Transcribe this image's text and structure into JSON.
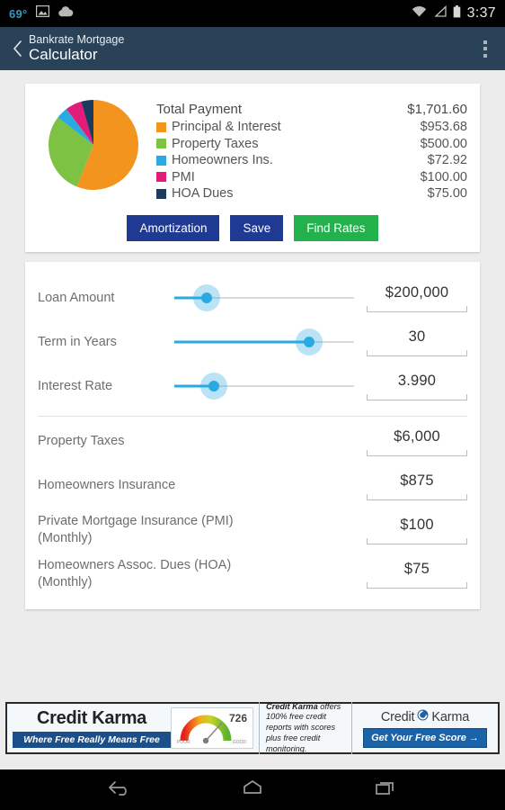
{
  "statusbar": {
    "temperature": "69°",
    "photo_icon": "photo-icon",
    "cloud_icon": "cloud-upload-icon",
    "wifi_icon": "wifi-icon",
    "signal_icon": "signal-icon",
    "battery_icon": "battery-icon",
    "time": "3:37"
  },
  "appbar": {
    "back_icon": "back-chevron-icon",
    "title_line1": "Bankrate Mortgage",
    "title_line2": "Calculator",
    "overflow_icon": "overflow-menu-icon"
  },
  "summary": {
    "total_label": "Total Payment",
    "total_value": "$1,701.60",
    "legend": [
      {
        "label": "Principal & Interest",
        "value": "$953.68",
        "color": "#F2941E"
      },
      {
        "label": "Property Taxes",
        "value": "$500.00",
        "color": "#7DC242"
      },
      {
        "label": "Homeowners Ins.",
        "value": "$72.92",
        "color": "#29ABE2"
      },
      {
        "label": "PMI",
        "value": "$100.00",
        "color": "#E31C79"
      },
      {
        "label": "HOA Dues",
        "value": "$75.00",
        "color": "#1C3A5E"
      }
    ]
  },
  "chart_data": {
    "type": "pie",
    "title": "Total Payment",
    "labels": [
      "Principal & Interest",
      "Property Taxes",
      "Homeowners Ins.",
      "PMI",
      "HOA Dues"
    ],
    "values": [
      953.68,
      500.0,
      72.92,
      100.0,
      75.0
    ],
    "total": 1701.6,
    "percentages": [
      56.0,
      29.4,
      4.3,
      5.9,
      4.4
    ],
    "colors": [
      "#F2941E",
      "#7DC242",
      "#29ABE2",
      "#E31C79",
      "#1C3A5E"
    ],
    "legend_position": "right",
    "grid": false
  },
  "buttons": {
    "amortization": "Amortization",
    "save": "Save",
    "find_rates": "Find Rates",
    "navy_color": "#1F3A93",
    "green_color": "#22B14C"
  },
  "sliders": [
    {
      "label": "Loan Amount",
      "value": "$200,000",
      "percent": 18
    },
    {
      "label": "Term in Years",
      "value": "30",
      "percent": 75
    },
    {
      "label": "Interest Rate",
      "value": "3.990",
      "percent": 22
    }
  ],
  "inputs": [
    {
      "label": "Property Taxes",
      "value": "$6,000"
    },
    {
      "label": "Homeowners Insurance",
      "value": "$875"
    },
    {
      "label": "Private Mortgage Insurance (PMI) (Monthly)",
      "value": "$100"
    },
    {
      "label": "Homeowners Assoc. Dues (HOA) (Monthly)",
      "value": "$75"
    }
  ],
  "ad": {
    "brand": "Credit Karma",
    "tagline_plain": "Where Free ",
    "tagline_bold": "Really Means Free",
    "gauge_score": "726",
    "gauge_low": "POOR",
    "gauge_high": "GOOD",
    "copy_bold": "Credit Karma",
    "copy_rest": " offers 100% free credit reports with scores plus free credit monitoring.",
    "logo_left": "Credit",
    "logo_right": "Karma",
    "cta": "Get Your Free Score →"
  },
  "navbar": {
    "back_icon": "nav-back-icon",
    "home_icon": "nav-home-icon",
    "recents_icon": "nav-recents-icon"
  }
}
